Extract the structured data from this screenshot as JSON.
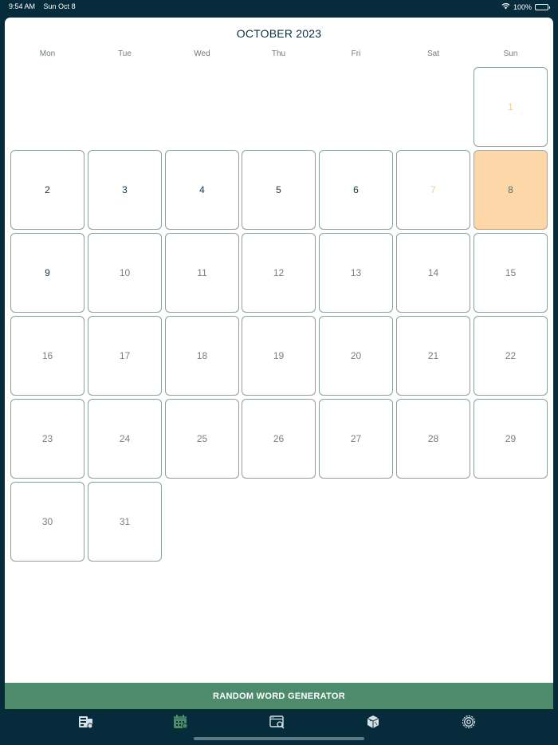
{
  "status_bar": {
    "time": "9:54 AM",
    "date": "Sun Oct 8",
    "battery": "100%"
  },
  "calendar": {
    "title": "OCTOBER 2023",
    "weekdays": [
      "Mon",
      "Tue",
      "Wed",
      "Thu",
      "Fri",
      "Sat",
      "Sun"
    ],
    "days": [
      "1",
      "2",
      "3",
      "4",
      "5",
      "6",
      "7",
      "8",
      "9",
      "10",
      "11",
      "12",
      "13",
      "14",
      "15",
      "16",
      "17",
      "18",
      "19",
      "20",
      "21",
      "22",
      "23",
      "24",
      "25",
      "26",
      "27",
      "28",
      "29",
      "30",
      "31"
    ],
    "today": "8"
  },
  "generator": {
    "label": "RANDOM WORD GENERATOR"
  },
  "tabs": [
    {
      "icon": "word-list-icon",
      "active": false
    },
    {
      "icon": "calendar-icon",
      "active": true
    },
    {
      "icon": "browser-search-icon",
      "active": false
    },
    {
      "icon": "cube-icon",
      "active": false
    },
    {
      "icon": "settings-gear-icon",
      "active": false
    }
  ],
  "colors": {
    "background": "#062c3c",
    "accent_green": "#4d8b6c",
    "today_highlight": "#fdd7a8",
    "weekend_past": "#f2c98a"
  }
}
